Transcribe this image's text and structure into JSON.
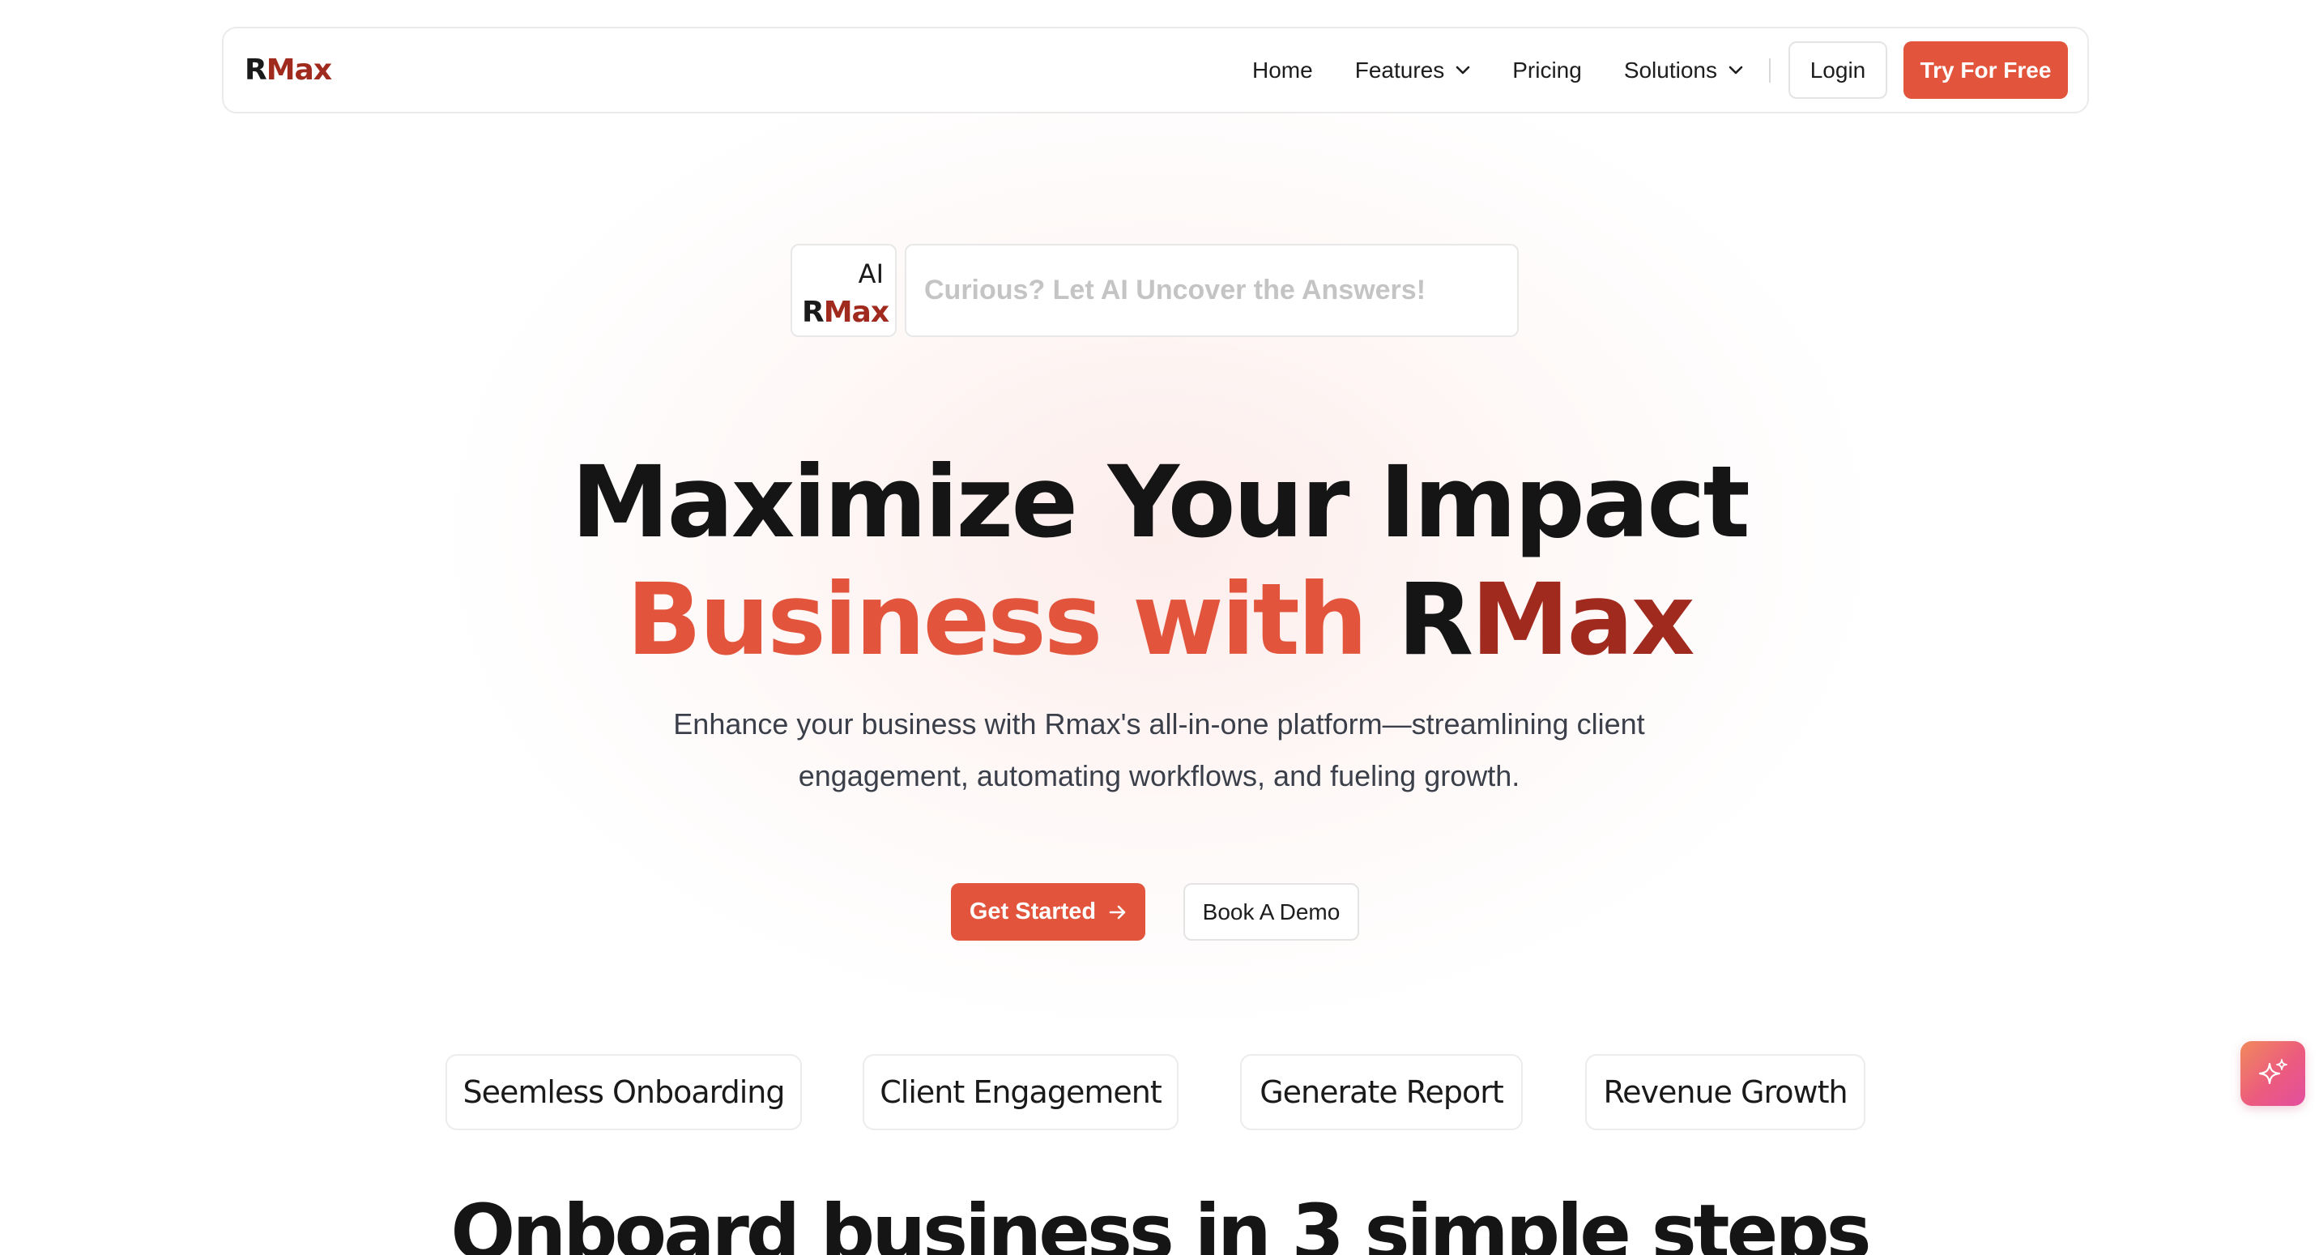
{
  "brand": {
    "r": "R",
    "max": "Max"
  },
  "nav": {
    "items": [
      {
        "label": "Home"
      },
      {
        "label": "Features"
      },
      {
        "label": "Pricing"
      },
      {
        "label": "Solutions"
      }
    ],
    "login_label": "Login",
    "try_label": "Try For Free"
  },
  "ai_search": {
    "badge_ai": "AI",
    "badge_r": "R",
    "badge_max": "Max",
    "placeholder": "Curious? Let AI Uncover the Answers!"
  },
  "hero": {
    "line1": "Maximize Your Impact",
    "line2_orange": "Business with",
    "line2_r": "R",
    "line2_max": "Max",
    "subtitle_1": "Enhance your business with Rmax's all-in-one platform—streamlining client",
    "subtitle_2": "engagement, automating workflows, and fueling growth.",
    "get_started_label": "Get Started",
    "book_demo_label": "Book A Demo"
  },
  "features": [
    "Seemless Onboarding",
    "Client Engagement",
    "Generate Report",
    "Revenue Growth"
  ],
  "section_title": "Onboard business in 3 simple steps",
  "colors": {
    "accent": "#e2553c",
    "brand_dark_red": "#a12a1e",
    "text_dark": "#151515"
  },
  "icons": {
    "dropdown": "chevron-down-icon",
    "cta_arrow": "arrow-right-icon",
    "fab": "sparkles-icon"
  }
}
